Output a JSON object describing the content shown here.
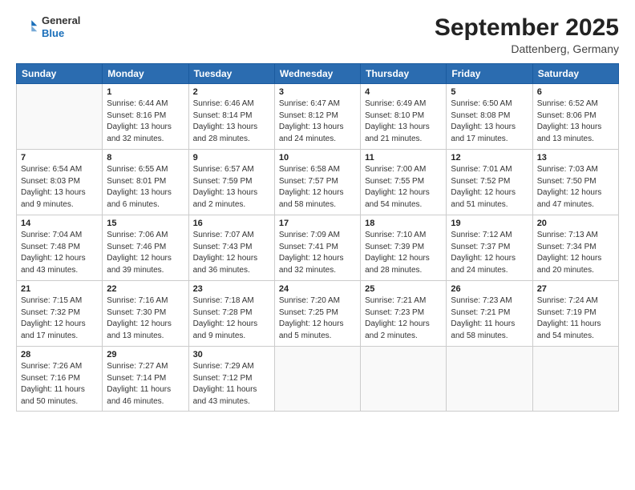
{
  "header": {
    "logo_general": "General",
    "logo_blue": "Blue",
    "month_title": "September 2025",
    "location": "Dattenberg, Germany"
  },
  "days_of_week": [
    "Sunday",
    "Monday",
    "Tuesday",
    "Wednesday",
    "Thursday",
    "Friday",
    "Saturday"
  ],
  "weeks": [
    [
      {
        "day": "",
        "sunrise": "",
        "sunset": "",
        "daylight": ""
      },
      {
        "day": "1",
        "sunrise": "Sunrise: 6:44 AM",
        "sunset": "Sunset: 8:16 PM",
        "daylight": "Daylight: 13 hours and 32 minutes."
      },
      {
        "day": "2",
        "sunrise": "Sunrise: 6:46 AM",
        "sunset": "Sunset: 8:14 PM",
        "daylight": "Daylight: 13 hours and 28 minutes."
      },
      {
        "day": "3",
        "sunrise": "Sunrise: 6:47 AM",
        "sunset": "Sunset: 8:12 PM",
        "daylight": "Daylight: 13 hours and 24 minutes."
      },
      {
        "day": "4",
        "sunrise": "Sunrise: 6:49 AM",
        "sunset": "Sunset: 8:10 PM",
        "daylight": "Daylight: 13 hours and 21 minutes."
      },
      {
        "day": "5",
        "sunrise": "Sunrise: 6:50 AM",
        "sunset": "Sunset: 8:08 PM",
        "daylight": "Daylight: 13 hours and 17 minutes."
      },
      {
        "day": "6",
        "sunrise": "Sunrise: 6:52 AM",
        "sunset": "Sunset: 8:06 PM",
        "daylight": "Daylight: 13 hours and 13 minutes."
      }
    ],
    [
      {
        "day": "7",
        "sunrise": "Sunrise: 6:54 AM",
        "sunset": "Sunset: 8:03 PM",
        "daylight": "Daylight: 13 hours and 9 minutes."
      },
      {
        "day": "8",
        "sunrise": "Sunrise: 6:55 AM",
        "sunset": "Sunset: 8:01 PM",
        "daylight": "Daylight: 13 hours and 6 minutes."
      },
      {
        "day": "9",
        "sunrise": "Sunrise: 6:57 AM",
        "sunset": "Sunset: 7:59 PM",
        "daylight": "Daylight: 13 hours and 2 minutes."
      },
      {
        "day": "10",
        "sunrise": "Sunrise: 6:58 AM",
        "sunset": "Sunset: 7:57 PM",
        "daylight": "Daylight: 12 hours and 58 minutes."
      },
      {
        "day": "11",
        "sunrise": "Sunrise: 7:00 AM",
        "sunset": "Sunset: 7:55 PM",
        "daylight": "Daylight: 12 hours and 54 minutes."
      },
      {
        "day": "12",
        "sunrise": "Sunrise: 7:01 AM",
        "sunset": "Sunset: 7:52 PM",
        "daylight": "Daylight: 12 hours and 51 minutes."
      },
      {
        "day": "13",
        "sunrise": "Sunrise: 7:03 AM",
        "sunset": "Sunset: 7:50 PM",
        "daylight": "Daylight: 12 hours and 47 minutes."
      }
    ],
    [
      {
        "day": "14",
        "sunrise": "Sunrise: 7:04 AM",
        "sunset": "Sunset: 7:48 PM",
        "daylight": "Daylight: 12 hours and 43 minutes."
      },
      {
        "day": "15",
        "sunrise": "Sunrise: 7:06 AM",
        "sunset": "Sunset: 7:46 PM",
        "daylight": "Daylight: 12 hours and 39 minutes."
      },
      {
        "day": "16",
        "sunrise": "Sunrise: 7:07 AM",
        "sunset": "Sunset: 7:43 PM",
        "daylight": "Daylight: 12 hours and 36 minutes."
      },
      {
        "day": "17",
        "sunrise": "Sunrise: 7:09 AM",
        "sunset": "Sunset: 7:41 PM",
        "daylight": "Daylight: 12 hours and 32 minutes."
      },
      {
        "day": "18",
        "sunrise": "Sunrise: 7:10 AM",
        "sunset": "Sunset: 7:39 PM",
        "daylight": "Daylight: 12 hours and 28 minutes."
      },
      {
        "day": "19",
        "sunrise": "Sunrise: 7:12 AM",
        "sunset": "Sunset: 7:37 PM",
        "daylight": "Daylight: 12 hours and 24 minutes."
      },
      {
        "day": "20",
        "sunrise": "Sunrise: 7:13 AM",
        "sunset": "Sunset: 7:34 PM",
        "daylight": "Daylight: 12 hours and 20 minutes."
      }
    ],
    [
      {
        "day": "21",
        "sunrise": "Sunrise: 7:15 AM",
        "sunset": "Sunset: 7:32 PM",
        "daylight": "Daylight: 12 hours and 17 minutes."
      },
      {
        "day": "22",
        "sunrise": "Sunrise: 7:16 AM",
        "sunset": "Sunset: 7:30 PM",
        "daylight": "Daylight: 12 hours and 13 minutes."
      },
      {
        "day": "23",
        "sunrise": "Sunrise: 7:18 AM",
        "sunset": "Sunset: 7:28 PM",
        "daylight": "Daylight: 12 hours and 9 minutes."
      },
      {
        "day": "24",
        "sunrise": "Sunrise: 7:20 AM",
        "sunset": "Sunset: 7:25 PM",
        "daylight": "Daylight: 12 hours and 5 minutes."
      },
      {
        "day": "25",
        "sunrise": "Sunrise: 7:21 AM",
        "sunset": "Sunset: 7:23 PM",
        "daylight": "Daylight: 12 hours and 2 minutes."
      },
      {
        "day": "26",
        "sunrise": "Sunrise: 7:23 AM",
        "sunset": "Sunset: 7:21 PM",
        "daylight": "Daylight: 11 hours and 58 minutes."
      },
      {
        "day": "27",
        "sunrise": "Sunrise: 7:24 AM",
        "sunset": "Sunset: 7:19 PM",
        "daylight": "Daylight: 11 hours and 54 minutes."
      }
    ],
    [
      {
        "day": "28",
        "sunrise": "Sunrise: 7:26 AM",
        "sunset": "Sunset: 7:16 PM",
        "daylight": "Daylight: 11 hours and 50 minutes."
      },
      {
        "day": "29",
        "sunrise": "Sunrise: 7:27 AM",
        "sunset": "Sunset: 7:14 PM",
        "daylight": "Daylight: 11 hours and 46 minutes."
      },
      {
        "day": "30",
        "sunrise": "Sunrise: 7:29 AM",
        "sunset": "Sunset: 7:12 PM",
        "daylight": "Daylight: 11 hours and 43 minutes."
      },
      {
        "day": "",
        "sunrise": "",
        "sunset": "",
        "daylight": ""
      },
      {
        "day": "",
        "sunrise": "",
        "sunset": "",
        "daylight": ""
      },
      {
        "day": "",
        "sunrise": "",
        "sunset": "",
        "daylight": ""
      },
      {
        "day": "",
        "sunrise": "",
        "sunset": "",
        "daylight": ""
      }
    ]
  ]
}
